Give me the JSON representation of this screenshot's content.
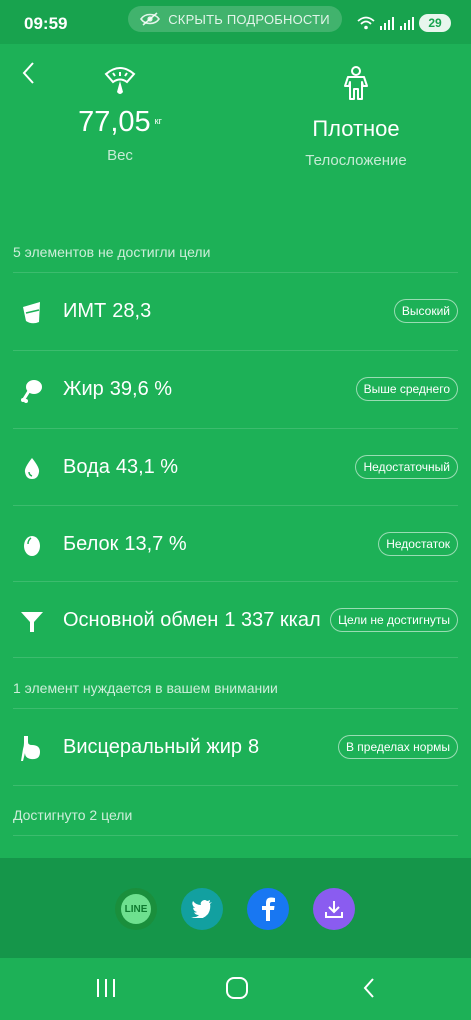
{
  "status_bar": {
    "time": "09:59",
    "hide_details": "СКРЫТЬ ПОДРОБНОСТИ",
    "battery": "29"
  },
  "header": {
    "weight_value": "77,05",
    "weight_unit": "кг",
    "weight_caption": "Вес",
    "build_value": "Плотное",
    "build_caption": "Телосложение"
  },
  "sections": {
    "not_reached": "5 элементов не достигли цели",
    "attention": "1 элемент нуждается в вашем внимании",
    "reached": "Достигнуто 2 цели"
  },
  "items": [
    {
      "label": "ИМТ",
      "value": "28,3",
      "badge": "Высокий",
      "icon": "glass-icon"
    },
    {
      "label": "Жир",
      "value": "39,6 %",
      "badge": "Выше среднего",
      "icon": "drumstick-icon"
    },
    {
      "label": "Вода",
      "value": "43,1 %",
      "badge": "Недостаточный",
      "icon": "water-drop-icon"
    },
    {
      "label": "Белок",
      "value": "13,7 %",
      "badge": "Недостаток",
      "icon": "egg-icon"
    },
    {
      "label": "Основной обмен",
      "value": "1 337 ккал",
      "badge": "Цели не достигнуты",
      "icon": "funnel-icon"
    },
    {
      "label": "Висцеральный жир",
      "value": "8",
      "badge": "В пределах нормы",
      "icon": "stomach-icon"
    }
  ],
  "share": {
    "line_label": "LINE"
  },
  "colors": {
    "background": "#1db157",
    "share_bar": "#15964a",
    "facebook": "#1877f2",
    "twitter": "#12a0a0",
    "download": "#8a5cf0",
    "line": "#1a8f3c"
  }
}
